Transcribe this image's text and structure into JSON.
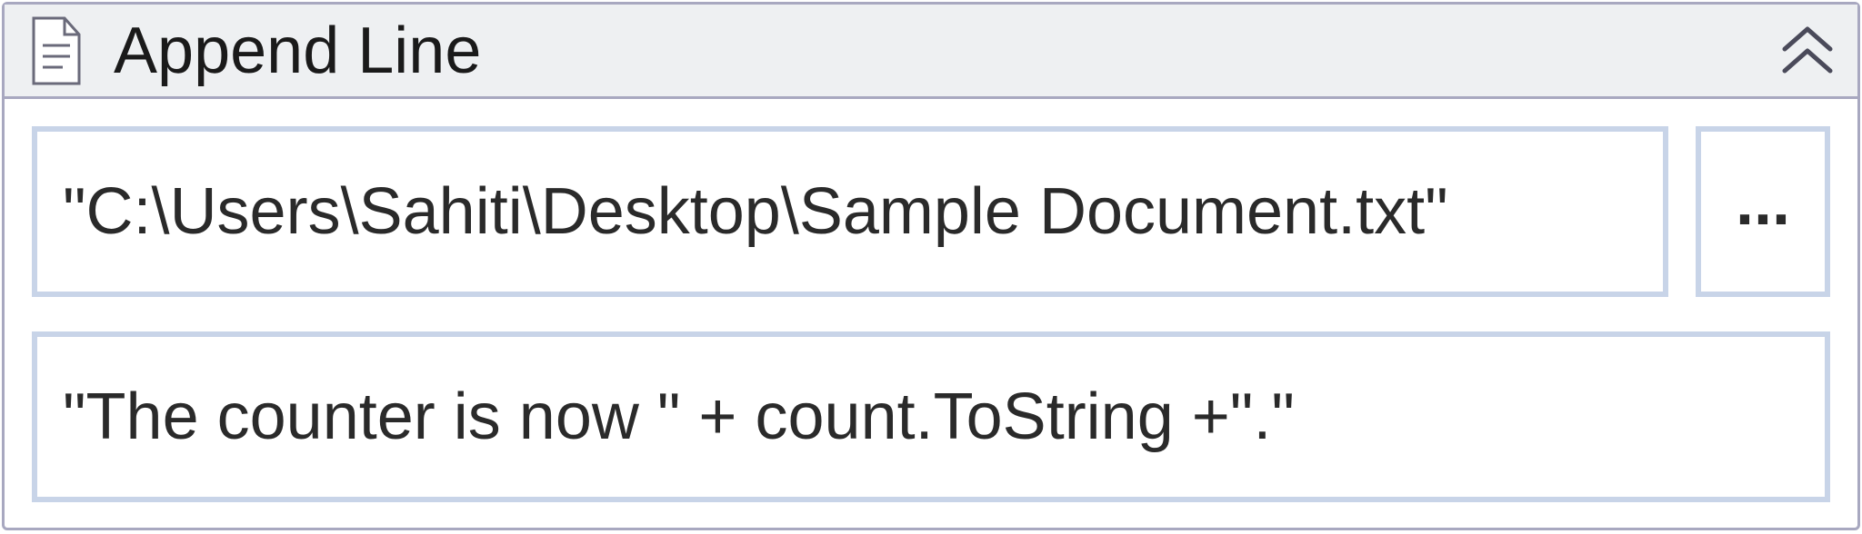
{
  "activity": {
    "title": "Append Line",
    "filePath": "\"C:\\Users\\Sahiti\\Desktop\\Sample Document.txt\"",
    "browseLabel": "...",
    "lineContent": "\"The counter is now \" + count.ToString +\".\""
  }
}
